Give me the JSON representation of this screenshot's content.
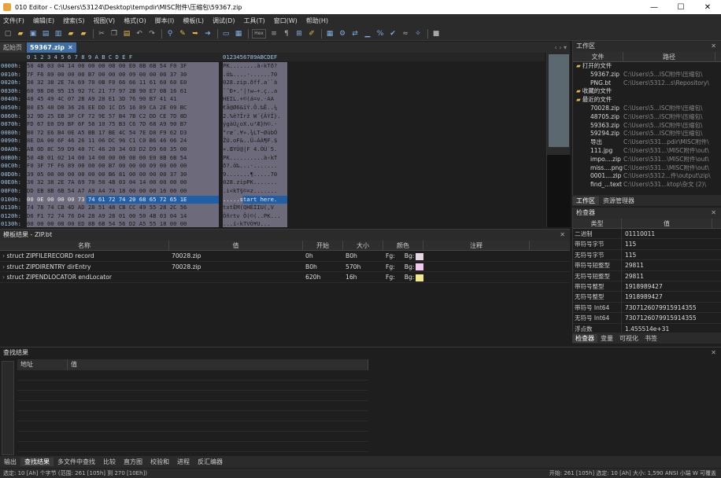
{
  "window": {
    "title": "010 Editor - C:\\Users\\53124\\Desktop\\tempdir\\MISC附件\\压缩包\\59367.zip",
    "minimize": "—",
    "maximize": "☐",
    "close": "✕"
  },
  "menu": [
    "文件(F)",
    "编辑(E)",
    "搜索(S)",
    "视图(V)",
    "格式(O)",
    "脚本(I)",
    "模板(L)",
    "调试(D)",
    "工具(T)",
    "窗口(W)",
    "帮助(H)"
  ],
  "tabs": {
    "start": "起始页",
    "file": "59367.zip",
    "close": "✕",
    "nav": "‹ ›  ▾"
  },
  "hex": {
    "header_offsets": "0 1 2 3 4 5 6 7 8 9 A B C D E F",
    "header_ascii": "0123456789ABCDEF",
    "rows": [
      {
        "addr": "0000h:",
        "bytes": "50 4B 03 04 14 00 00 00 08 00 E0 8B 6B 54 F0 3F",
        "ascii": "PK........à‹kTð?"
      },
      {
        "addr": "0010h:",
        "bytes": "7F F6 89 00 00 00 B7 00 00 00 09 00 00 00 37 30",
        "ascii": ".ö‰....·......70"
      },
      {
        "addr": "0020h:",
        "bytes": "30 32 38 2E 7A 69 70 0B F0 66 66 11 61 60 60 E0",
        "ascii": "028.zip.ðff.a``à"
      },
      {
        "addr": "0030h:",
        "bytes": "60 98 D0 95 15 92 7C 21 77 97 2B 90 E7 0B 16 61",
        "ascii": "`˜Ð•.'|!w—+.ç..a"
      },
      {
        "addr": "0040h:",
        "bytes": "48 45 49 4C 07 2B A9 28 E1 3D 76 90 B7 41 41",
        "ascii": "HEIL.+©(á=v.·AA"
      },
      {
        "addr": "0050h:",
        "bytes": "80 E5 40 D8 36 26 EE DD 1C D5 16 89 CA 2E 09 BC",
        "ascii": "€å@Ø6&îÝ.Õ.‰Ê..¼"
      },
      {
        "addr": "0060h:",
        "bytes": "32 9D 25 EB 3F CF 72 9E 57 B4 7B C2 DD CE 7D 8D",
        "ascii": "2.%ë?Ïrž W´{ÂÝÎ}."
      },
      {
        "addr": "0070h:",
        "bytes": "FD 67 E0 D9 BF 6F 58 10 75 B3 C6 7D 68 A9 90 B7",
        "ascii": "ýgàÙ¿oX.u³Æ}h©.·"
      },
      {
        "addr": "0080h:",
        "bytes": "B0 72 E6 B4 0E A5 BB 17 BE 4C 54 7E D8 F9 62 D3",
        "ascii": "°ræ´.¥».¾LT~ØùbÓ"
      },
      {
        "addr": "0090h:",
        "bytes": "8E DA 00 6F 46 26 11 06 DC 96 C1 C0 B6 46 06 24",
        "ascii": "ŽÚ.oF&..Ü–ÁÀ¶F.$"
      },
      {
        "addr": "00A0h:",
        "bytes": "AB 0D 8C 59 D9 40 7C 46 20 34 03 D2 D9 60 35 00",
        "ascii": "«.ŒYÙ@|F 4.ÒÙ`5."
      },
      {
        "addr": "00B0h:",
        "bytes": "50 4B 01 02 14 00 14 00 00 00 08 00 E0 8B 6B 54",
        "ascii": "PK..........à‹kT"
      },
      {
        "addr": "00C0h:",
        "bytes": "F0 3F 7F F6 89 00 00 00 B7 00 00 00 09 00 00 00",
        "ascii": "ð?.ö‰...·......."
      },
      {
        "addr": "00D0h:",
        "bytes": "39 05 00 00 00 00 00 00 B6 81 00 00 00 00 37 30",
        "ascii": "9.......¶.....70"
      },
      {
        "addr": "00E0h:",
        "bytes": "30 32 38 2E 7A 69 70 50 4B 03 04 14 00 00 00 00",
        "ascii": "028.zipPK......."
      },
      {
        "addr": "00F0h:",
        "bytes": "DD EB 8B 6B 54 A7 A9 A4 7A 18 00 00 00 16 00 00",
        "ascii": ".i<kT§©¤z......."
      },
      {
        "addr": "0100h:",
        "bytes": "00 0E 00 00 00 73 74 61 72 74 20 68 65 72 65 1E",
        "ascii": ".....start here."
      },
      {
        "addr": "0110h:",
        "bytes": "74 78 74 CB 4D AD 28 51 48 CB CC 49 55 28 2C 56",
        "ascii": "txtËM­(QHËÌIU(,V"
      },
      {
        "addr": "0120h:",
        "bytes": "D6 F1 72 74 76 D4 28 A9 28 01 00 50 4B 03 04 14",
        "ascii": "Öñrtv Ô(©(..PK..."
      },
      {
        "addr": "0130h:",
        "bytes": "00 00 00 08 00 ED 8B 6B 54 56 D2 A5 55 18 00 00",
        "ascii": "...í‹kTVÒ¥U..."
      },
      {
        "addr": "0140h:",
        "bytes": "00 16 00 00 00 09 00 00 00 54 4A 41 43 41 2E 74",
        "ascii": ".........TJACA.t"
      },
      {
        "addr": "0150h:",
        "bytes": "78 74 CB 4D AD 28 51 48 CB CC 49 55 28 2C 56 88",
        "ascii": "xtËM­(QHËÌIU(,V."
      }
    ]
  },
  "workspace": {
    "title": "工作区",
    "col_file": "文件",
    "col_path": "路径",
    "rows": [
      {
        "name": "打开的文件",
        "path": "",
        "folder": true
      },
      {
        "name": "59367.zip",
        "path": "C:\\Users\\5...ISC附件\\压缩包\\"
      },
      {
        "name": "PNG.bt",
        "path": "C:\\Users\\5312...s\\Repository\\"
      },
      {
        "name": "收藏的文件",
        "path": "",
        "folder": true
      },
      {
        "name": "最近的文件",
        "path": "",
        "folder": true
      },
      {
        "name": "70028.zip",
        "path": "C:\\Users\\5...ISC附件\\压缩包\\"
      },
      {
        "name": "48705.zip",
        "path": "C:\\Users\\5...ISC附件\\压缩包\\"
      },
      {
        "name": "59363.zip",
        "path": "C:\\Users\\5...ISC附件\\压缩包\\"
      },
      {
        "name": "59294.zip",
        "path": "C:\\Users\\5...ISC附件\\压缩包\\"
      },
      {
        "name": "导出",
        "path": "C:\\Users\\531...pdir\\MISC附件\\"
      },
      {
        "name": "111.jpg",
        "path": "C:\\Users\\531...\\MISC附件\\out\\"
      },
      {
        "name": "impo....zip",
        "path": "C:\\Users\\531...\\MISC附件\\out\\"
      },
      {
        "name": "miss....png",
        "path": "C:\\Users\\531...\\MISC附件\\out\\"
      },
      {
        "name": "0001....zip",
        "path": "C:\\Users\\5312...件\\output\\zip\\"
      },
      {
        "name": "find_...text",
        "path": "C:\\Users\\531...ktop\\杂文 (2)\\"
      }
    ],
    "tab_workspace": "工作区",
    "tab_resources": "资源管理器"
  },
  "inspector": {
    "title": "检查器",
    "col_type": "类型",
    "col_value": "值",
    "rows": [
      {
        "k": "二进制",
        "v": "01110011"
      },
      {
        "k": "带符号字节",
        "v": "115"
      },
      {
        "k": "无符号字节",
        "v": "115"
      },
      {
        "k": "带符号短整型",
        "v": "29811"
      },
      {
        "k": "无符号短整型",
        "v": "29811"
      },
      {
        "k": "带符号整型",
        "v": "1918989427"
      },
      {
        "k": "无符号整型",
        "v": "1918989427"
      },
      {
        "k": "带符号 Int64",
        "v": "7307126079915914355"
      },
      {
        "k": "无符号 Int64",
        "v": "7307126079915914355"
      },
      {
        "k": "浮点数",
        "v": "1.455514e+31"
      }
    ],
    "tabs": [
      "检查器",
      "变量",
      "可视化",
      "书签"
    ]
  },
  "template": {
    "title": "模板结果 - ZIP.bt",
    "columns": [
      "名称",
      "值",
      "开始",
      "大小",
      "颜色",
      "注释"
    ],
    "rows": [
      {
        "name": "struct ZIPFILERECORD record",
        "value": "70028.zip",
        "start": "0h",
        "size": "B0h",
        "fg": "Fg:",
        "bg": "Bg:",
        "color": "#e4d6e4"
      },
      {
        "name": "struct ZIPDIRENTRY dirEntry",
        "value": "70028.zip",
        "start": "B0h",
        "size": "570h",
        "fg": "Fg:",
        "bg": "Bg:",
        "color": "#f0c8f0"
      },
      {
        "name": "struct ZIPENDLOCATOR endLocator",
        "value": "",
        "start": "620h",
        "size": "16h",
        "fg": "Fg:",
        "bg": "Bg:",
        "color": "#f2e98c"
      }
    ]
  },
  "find": {
    "title": "查找结果",
    "col_address": "地址",
    "col_value": "值"
  },
  "bottom_tabs": [
    "输出",
    "查找结果",
    "多文件中查找",
    "比较",
    "直方图",
    "校验和",
    "进程",
    "反汇编器"
  ],
  "status": {
    "left": "选定: 10 [Ah] 个字节 (范围: 261 [105h] 到 270 [10Eh])",
    "right": "开始: 261 [105h]   选定: 10 [Ah]   大小: 1,590     ANSI  小端     W  可覆盖"
  }
}
